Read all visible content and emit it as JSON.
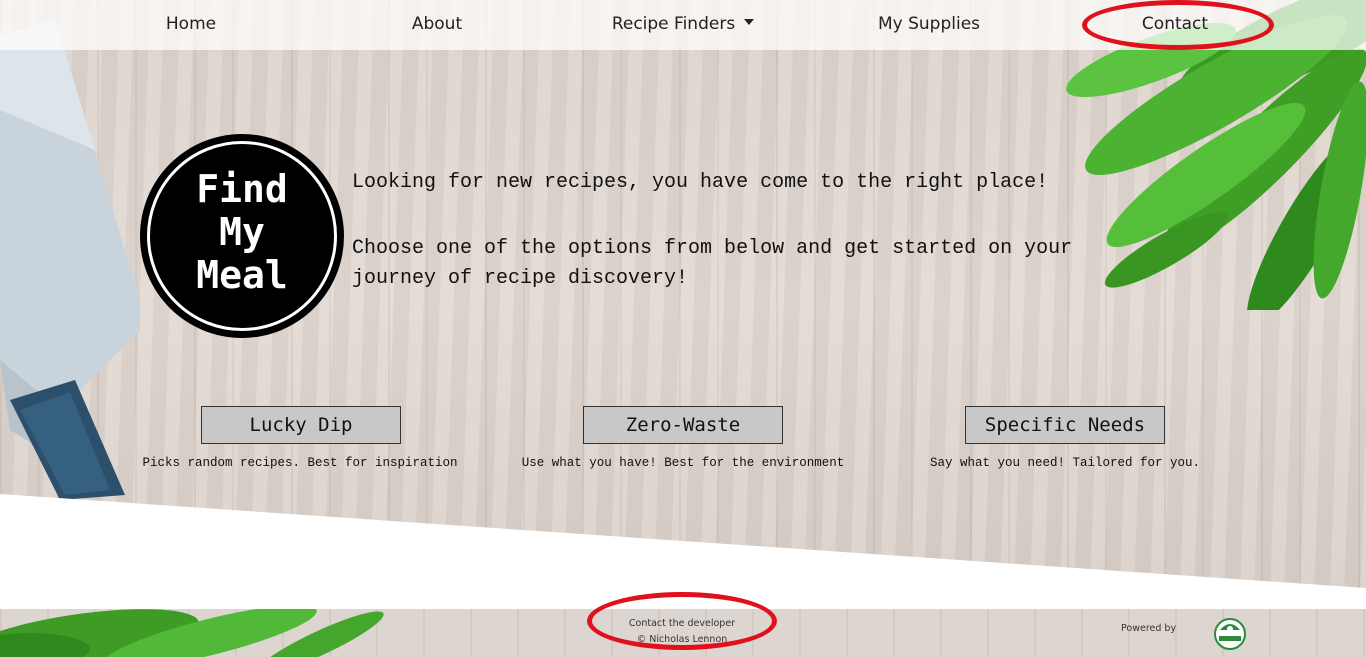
{
  "nav": {
    "items": [
      {
        "label": "Home"
      },
      {
        "label": "About"
      },
      {
        "label": "Recipe Finders"
      },
      {
        "label": "My Supplies"
      },
      {
        "label": "Contact"
      }
    ]
  },
  "logo": {
    "line1": "Find",
    "line2": "My",
    "line3": "Meal"
  },
  "intro": {
    "line1": "Looking for new recipes, you have come to the right place!",
    "line2": "Choose one of the options from below and get started on your journey of recipe discovery!"
  },
  "options": [
    {
      "label": "Lucky Dip",
      "description": "Picks random recipes. Best for inspiration"
    },
    {
      "label": "Zero-Waste",
      "description": "Use what you have! Best for the environment"
    },
    {
      "label": "Specific Needs",
      "description": "Say what you need! Tailored for you."
    }
  ],
  "footer": {
    "contact": "Contact the developer",
    "copyright": "© Nicholas Lennon",
    "powered_by": "Powered by"
  },
  "colors": {
    "annotation": "#e0101c",
    "button_bg": "#c8c8c8",
    "leaf": "#3f9e2a"
  },
  "icons": {
    "dropdown": "caret-down-icon",
    "api_logo": "spoonacular-logo"
  }
}
